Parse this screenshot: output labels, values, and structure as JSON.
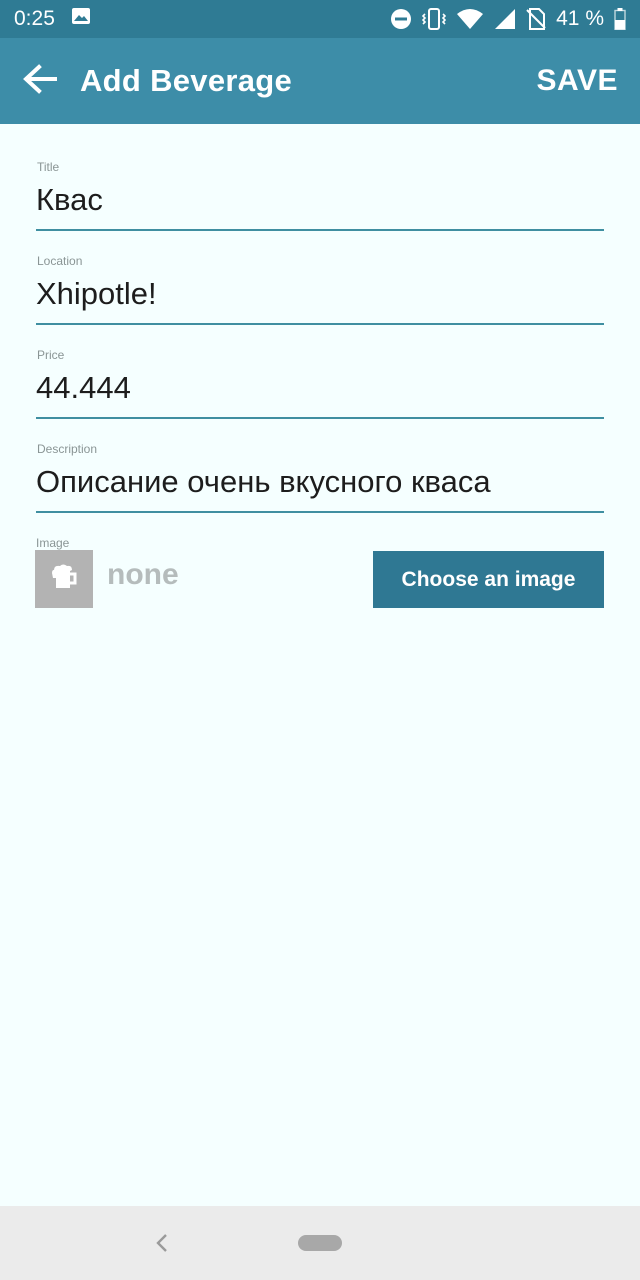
{
  "status_bar": {
    "time": "0:25",
    "battery": "41 %",
    "icons": [
      "image-icon",
      "do-not-disturb-icon",
      "vibrate-icon",
      "wifi-icon",
      "signal-icon",
      "no-sim-icon",
      "battery-icon"
    ]
  },
  "app_bar": {
    "title": "Add Beverage",
    "save_label": "SAVE",
    "back_icon": "arrow-back-icon"
  },
  "form": {
    "fields": [
      {
        "label": "Title",
        "value": "Квас"
      },
      {
        "label": "Location",
        "value": "Xhipotle!"
      },
      {
        "label": "Price",
        "value": "44.444"
      },
      {
        "label": "Description",
        "value": "Описание очень вкусного кваса"
      }
    ],
    "image": {
      "label": "Image",
      "value": "none",
      "thumbnail_icon": "beer-mug-icon",
      "button_label": "Choose an image"
    }
  },
  "colors": {
    "status_bar": "#2f7b94",
    "app_bar": "#3d8da8",
    "background": "#f5ffff",
    "accent": "#3f8fa1",
    "button": "#2f7893"
  },
  "nav_bar": {
    "back_icon": "nav-back-icon",
    "home_icon": "nav-home-pill"
  }
}
